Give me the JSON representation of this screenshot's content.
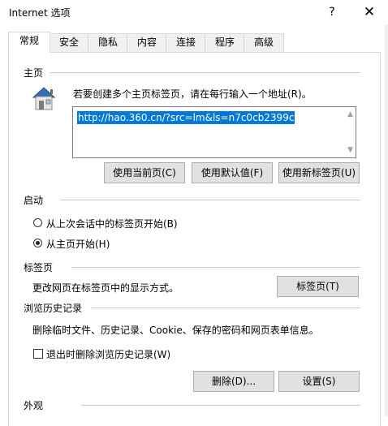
{
  "window": {
    "title": "Internet 选项",
    "help_glyph": "?",
    "close_glyph": "✕"
  },
  "tabs": [
    {
      "label": "常规",
      "active": true
    },
    {
      "label": "安全"
    },
    {
      "label": "隐私"
    },
    {
      "label": "内容"
    },
    {
      "label": "连接"
    },
    {
      "label": "程序"
    },
    {
      "label": "高级"
    }
  ],
  "home": {
    "section_title": "主页",
    "instruction": "若要创建多个主页标签页，请在每行输入一个地址(R)。",
    "url": "http://hao.360.cn/?src=lm&ls=n7c0cb2399c",
    "buttons": {
      "use_current": "使用当前页(C)",
      "use_default": "使用默认值(F)",
      "use_new_tab": "使用新标签页(U)"
    }
  },
  "startup": {
    "section_title": "启动",
    "option_last_session": "从上次会话中的标签页开始(B)",
    "option_home": "从主页开始(H)",
    "selected": "home"
  },
  "tabs_section": {
    "section_title": "标签页",
    "description": "更改网页在标签页中的显示方式。",
    "button": "标签页(T)"
  },
  "history": {
    "section_title": "浏览历史记录",
    "description": "删除临时文件、历史记录、Cookie、保存的密码和网页表单信息。",
    "checkbox_label": "退出时删除浏览历史记录(W)",
    "checked": false,
    "delete_button": "删除(D)...",
    "settings_button": "设置(S)"
  },
  "appearance": {
    "section_title": "外观"
  }
}
